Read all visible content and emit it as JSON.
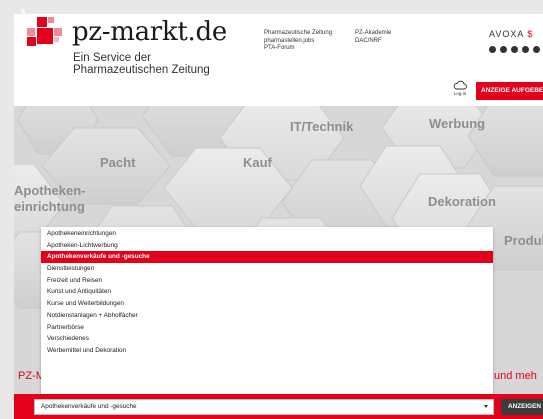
{
  "header": {
    "brand": "pz-markt.de",
    "subtitle_line1": "Ein Service der",
    "subtitle_line2": "Pharmazeutischen Zeitung",
    "nav_col1": [
      "Pharmazeutische Zeitung",
      "pharmastellen.jobs",
      "PTA-Forum"
    ],
    "nav_col2": [
      "PZ-Akademie",
      "DAC/NRF"
    ],
    "avoxa_main": "AVOXA",
    "avoxa_accent": "$",
    "login_label": "Log-in",
    "post_ad_button": "ANZEIGE AUFGEBEN",
    "social_icons": [
      "instagram-icon",
      "facebook-icon",
      "xing-icon",
      "linkedin-icon",
      "youtube-icon"
    ],
    "colors": {
      "accent": "#e2001a",
      "dark": "#333333"
    }
  },
  "hero": {
    "categories": {
      "it_technik": "IT/Technik",
      "werbung": "Werbung",
      "pacht": "Pacht",
      "kauf": "Kauf",
      "apotheken_line1": "Apotheken-",
      "apotheken_line2": "einrichtung",
      "dekoration": "Dekoration",
      "produk": "Produk"
    }
  },
  "dropdown": {
    "options": [
      "Apothekeneinrichtungen",
      "Apotheken-Lichtwerbung",
      "Apothekenverkäufe und -gesuche",
      "Dienstleistungen",
      "Freizeit und Reisen",
      "Kunst und Antiquitäten",
      "Kurse und Weiterbildungen",
      "Notdienstanlagen + Abholfächer",
      "Partnerbörse",
      "Verschiedenes",
      "Werbemittel und Dekoration"
    ],
    "selected_index": 2
  },
  "partial_text": {
    "left": "PZ-M",
    "right": "und meh"
  },
  "search": {
    "icon": "euro-icon",
    "selected_value": "Apothekenverkäufe und -gesuche",
    "button_label": "ANZEIGEN"
  }
}
